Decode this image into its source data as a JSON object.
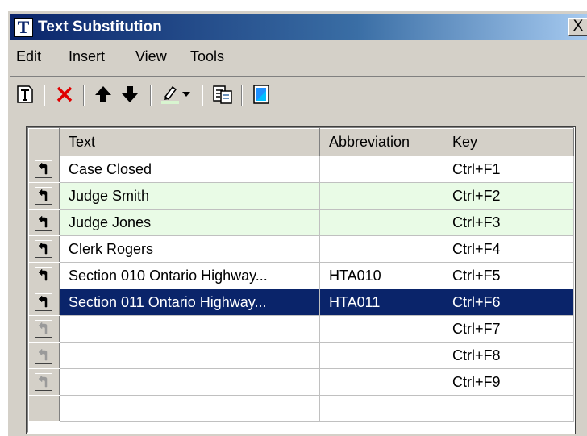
{
  "window": {
    "title": "Text Substitution",
    "close_label": "X"
  },
  "menu": [
    "Edit",
    "Insert",
    "View",
    "Tools"
  ],
  "toolbar": {
    "icons": [
      "new-entry-icon",
      "delete-icon",
      "move-up-icon",
      "move-down-icon",
      "highlight-color-icon",
      "dropdown-arrow-icon",
      "copy-icon",
      "properties-icon"
    ],
    "delete_color": "#e00000"
  },
  "grid": {
    "columns": [
      "Text",
      "Abbreviation",
      "Key"
    ],
    "rows": [
      {
        "text": "Case Closed",
        "abbreviation": "",
        "key": "Ctrl+F1"
      },
      {
        "text": "Judge Smith",
        "abbreviation": "",
        "key": "Ctrl+F2"
      },
      {
        "text": "Judge Jones",
        "abbreviation": "",
        "key": "Ctrl+F3"
      },
      {
        "text": "Clerk Rogers",
        "abbreviation": "",
        "key": "Ctrl+F4"
      },
      {
        "text": "Section 010 Ontario Highway...",
        "abbreviation": "HTA010",
        "key": "Ctrl+F5"
      },
      {
        "text": "Section 011 Ontario Highway...",
        "abbreviation": "HTA011",
        "key": "Ctrl+F6"
      },
      {
        "text": "",
        "abbreviation": "",
        "key": "Ctrl+F7"
      },
      {
        "text": "",
        "abbreviation": "",
        "key": "Ctrl+F8"
      },
      {
        "text": "",
        "abbreviation": "",
        "key": "Ctrl+F9"
      }
    ],
    "highlight_color": "#e9fbe6",
    "selected_color": "#0a246a"
  }
}
